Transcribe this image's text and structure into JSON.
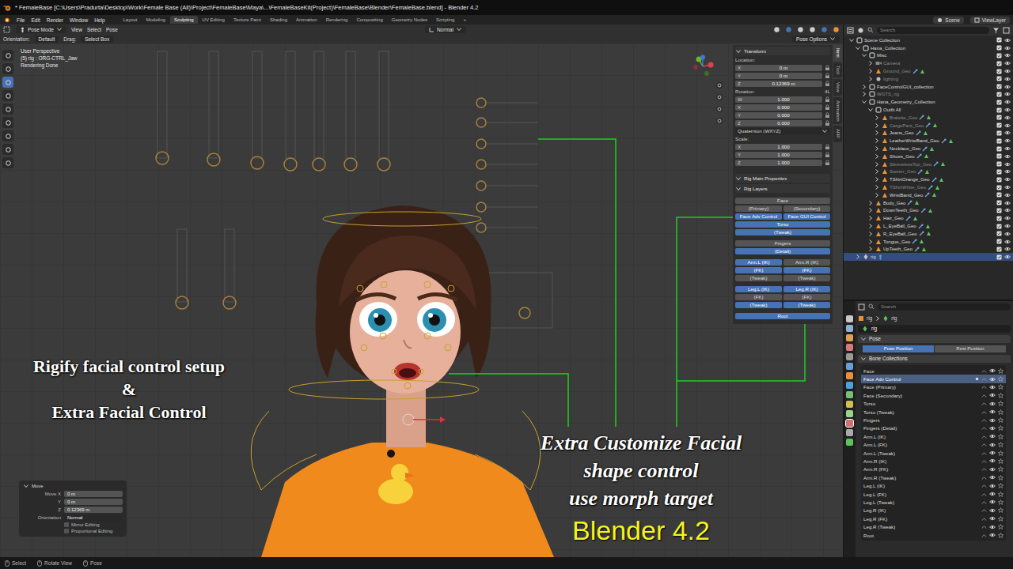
{
  "window": {
    "title": "* FemaleBase [C:\\Users\\Pradurta\\Desktop\\Work\\Female Base (All)\\Project\\FemaleBase\\Maya\\...\\FemaleBaseKit(Project)\\FemaleBase\\Blender\\FemaleBase.blend] - Blender 4.2"
  },
  "menu": [
    "File",
    "Edit",
    "Render",
    "Window",
    "Help"
  ],
  "workspaces": [
    {
      "label": "Layout",
      "selected": false
    },
    {
      "label": "Modeling",
      "selected": false
    },
    {
      "label": "Sculpting",
      "selected": true
    },
    {
      "label": "UV Editing",
      "selected": false
    },
    {
      "label": "Texture Paint",
      "selected": false
    },
    {
      "label": "Shading",
      "selected": false
    },
    {
      "label": "Animation",
      "selected": false
    },
    {
      "label": "Rendering",
      "selected": false
    },
    {
      "label": "Compositing",
      "selected": false
    },
    {
      "label": "Geometry Nodes",
      "selected": false
    },
    {
      "label": "Scripting",
      "selected": false
    },
    {
      "label": "+",
      "selected": false
    }
  ],
  "topbar_right": {
    "scene": "Scene",
    "view_layer": "ViewLayer"
  },
  "header": {
    "mode": "Pose Mode",
    "menus": [
      "View",
      "Select",
      "Pose"
    ],
    "transform": "Normal",
    "orientation_label": "Orientation:",
    "orientation": "Default",
    "drag_label": "Drag:",
    "drag": "Select Box",
    "options": "Pose Options"
  },
  "viewport": {
    "info": [
      "User Perspective",
      "(5) rig : ORG-CTRL_Jaw",
      "Rendering Done"
    ],
    "title_lines": [
      "Rigify facial control setup",
      "&",
      "Extra Facial Control"
    ],
    "caption_lines": [
      "Extra Customize Facial",
      "shape control",
      "use morph target"
    ],
    "version": "Blender 4.2"
  },
  "move_panel": {
    "title": "Move",
    "rows": [
      {
        "label": "Move X",
        "value": "0 m"
      },
      {
        "label": "Y",
        "value": "0 m"
      },
      {
        "label": "Z",
        "value": "0.12369 m"
      }
    ],
    "orientation_label": "Orientation",
    "orientation": "Normal",
    "checks": [
      {
        "label": "Mirror Editing",
        "checked": false
      },
      {
        "label": "Proportional Editing",
        "checked": false
      }
    ]
  },
  "npanel": {
    "tabs": [
      {
        "label": "Item",
        "selected": true
      },
      {
        "label": "Tool",
        "selected": false
      },
      {
        "label": "View",
        "selected": false
      },
      {
        "label": "Animation",
        "selected": false
      },
      {
        "label": "ARP",
        "selected": false
      }
    ],
    "transform": {
      "title": "Transform",
      "location_label": "Location:",
      "location": [
        {
          "axis": "X",
          "value": "0 m"
        },
        {
          "axis": "Y",
          "value": "0 m"
        },
        {
          "axis": "Z",
          "value": "0.12369 m"
        }
      ],
      "rotation_label": "Rotation:",
      "rotation_extra": "4L",
      "rotation": [
        {
          "axis": "W",
          "value": "1.000"
        },
        {
          "axis": "X",
          "value": "0.000"
        },
        {
          "axis": "Y",
          "value": "0.000"
        },
        {
          "axis": "Z",
          "value": "0.000"
        }
      ],
      "rotation_mode": "Quaternion (WXYZ)",
      "scale_label": "Scale:",
      "scale": [
        {
          "axis": "X",
          "value": "1.000"
        },
        {
          "axis": "Y",
          "value": "1.000"
        },
        {
          "axis": "Z",
          "value": "1.000"
        }
      ]
    },
    "sections": [
      "Rig Main Properties",
      "Rig Layers"
    ],
    "rig_layers": [
      [
        [
          {
            "label": "Face",
            "on": false
          }
        ],
        [
          {
            "label": "(Primary)",
            "on": false
          },
          {
            "label": "(Secondary)",
            "on": false
          }
        ],
        [
          {
            "label": "Face Adv Control",
            "on": true
          },
          {
            "label": "Face GUI Control",
            "on": true
          }
        ],
        [
          {
            "label": "Torso",
            "on": true
          }
        ],
        [
          {
            "label": "(Tweak)",
            "on": true
          }
        ]
      ],
      [
        [
          {
            "label": "Fingers",
            "on": false
          }
        ],
        [
          {
            "label": "(Detail)",
            "on": true
          }
        ]
      ],
      [
        [
          {
            "label": "Arm.L (IK)",
            "on": true
          },
          {
            "label": "Arm.R (IK)",
            "on": false
          }
        ],
        [
          {
            "label": "(FK)",
            "on": true
          },
          {
            "label": "(FK)",
            "on": true
          }
        ],
        [
          {
            "label": "(Tweak)",
            "on": false
          },
          {
            "label": "(Tweak)",
            "on": false
          }
        ]
      ],
      [
        [
          {
            "label": "Leg.L (IK)",
            "on": true
          },
          {
            "label": "Leg.R (IK)",
            "on": true
          }
        ],
        [
          {
            "label": "(FK)",
            "on": false
          },
          {
            "label": "(FK)",
            "on": false
          }
        ],
        [
          {
            "label": "(Tweak)",
            "on": true
          },
          {
            "label": "(Tweak)",
            "on": true
          }
        ]
      ],
      [
        [
          {
            "label": "Root",
            "on": true
          }
        ]
      ]
    ]
  },
  "outliner": {
    "search": "Search",
    "items": [
      {
        "label": "Scene Collection",
        "depth": 0,
        "kind": "collection",
        "expanded": true,
        "dim": false,
        "selected": false
      },
      {
        "label": "Hana_Collection",
        "depth": 1,
        "kind": "collection",
        "expanded": true,
        "dim": false,
        "selected": false
      },
      {
        "label": "Misc",
        "depth": 2,
        "kind": "collection",
        "expanded": true,
        "dim": false,
        "selected": false
      },
      {
        "label": "Camera",
        "depth": 3,
        "kind": "camera",
        "expanded": false,
        "dim": true,
        "selected": false
      },
      {
        "label": "Ground_Geo",
        "depth": 3,
        "kind": "mesh",
        "expanded": false,
        "dim": true,
        "selected": false
      },
      {
        "label": "lighting",
        "depth": 3,
        "kind": "light",
        "expanded": false,
        "dim": true,
        "selected": false
      },
      {
        "label": "FaceControlGUI_collection",
        "depth": 2,
        "kind": "collection",
        "expanded": false,
        "dim": false,
        "selected": false
      },
      {
        "label": "WGTS_rig",
        "depth": 2,
        "kind": "collection",
        "expanded": false,
        "dim": true,
        "selected": false
      },
      {
        "label": "Hana_Geometry_Collection",
        "depth": 2,
        "kind": "collection",
        "expanded": true,
        "dim": false,
        "selected": false
      },
      {
        "label": "Outfit All",
        "depth": 3,
        "kind": "collection",
        "expanded": true,
        "dim": false,
        "selected": false
      },
      {
        "label": "Bralette_Geo",
        "depth": 4,
        "kind": "mesh",
        "expanded": false,
        "dim": true,
        "selected": false
      },
      {
        "label": "CargoPant_Geo",
        "depth": 4,
        "kind": "mesh",
        "expanded": false,
        "dim": true,
        "selected": false
      },
      {
        "label": "Jeans_Geo",
        "depth": 4,
        "kind": "mesh",
        "expanded": false,
        "dim": false,
        "selected": false
      },
      {
        "label": "LeatherWristBand_Geo",
        "depth": 4,
        "kind": "mesh",
        "expanded": false,
        "dim": false,
        "selected": false
      },
      {
        "label": "Necklace_Geo",
        "depth": 4,
        "kind": "mesh",
        "expanded": false,
        "dim": false,
        "selected": false
      },
      {
        "label": "Shoes_Geo",
        "depth": 4,
        "kind": "mesh",
        "expanded": false,
        "dim": false,
        "selected": false
      },
      {
        "label": "SleevelessTop_Geo",
        "depth": 4,
        "kind": "mesh",
        "expanded": false,
        "dim": true,
        "selected": false
      },
      {
        "label": "Sweter_Geo",
        "depth": 4,
        "kind": "mesh",
        "expanded": false,
        "dim": true,
        "selected": false
      },
      {
        "label": "TShirtOrange_Geo",
        "depth": 4,
        "kind": "mesh",
        "expanded": false,
        "dim": false,
        "selected": false
      },
      {
        "label": "TShirtWhite_Geo",
        "depth": 4,
        "kind": "mesh",
        "expanded": false,
        "dim": true,
        "selected": false
      },
      {
        "label": "WristBand_Geo",
        "depth": 4,
        "kind": "mesh",
        "expanded": false,
        "dim": false,
        "selected": false
      },
      {
        "label": "Body_Geo",
        "depth": 3,
        "kind": "mesh",
        "expanded": false,
        "dim": false,
        "selected": false
      },
      {
        "label": "DownTeeth_Geo",
        "depth": 3,
        "kind": "mesh",
        "expanded": false,
        "dim": false,
        "selected": false
      },
      {
        "label": "Hair_Geo",
        "depth": 3,
        "kind": "mesh",
        "expanded": false,
        "dim": false,
        "selected": false
      },
      {
        "label": "L_EyeBall_Geo",
        "depth": 3,
        "kind": "mesh",
        "expanded": false,
        "dim": false,
        "selected": false
      },
      {
        "label": "R_EyeBall_Geo",
        "depth": 3,
        "kind": "mesh",
        "expanded": false,
        "dim": false,
        "selected": false
      },
      {
        "label": "Tongue_Geo",
        "depth": 3,
        "kind": "mesh",
        "expanded": false,
        "dim": false,
        "selected": false
      },
      {
        "label": "UpTeeth_Geo",
        "depth": 3,
        "kind": "mesh",
        "expanded": false,
        "dim": false,
        "selected": false
      },
      {
        "label": "rig",
        "depth": 1,
        "kind": "armature",
        "expanded": false,
        "dim": false,
        "selected": true
      }
    ]
  },
  "properties": {
    "search": "Search",
    "breadcrumb": [
      "rig",
      "rig"
    ],
    "name": "rig",
    "panel": "Pose",
    "positions": [
      {
        "label": "Pose Position",
        "selected": true
      },
      {
        "label": "Rest Position",
        "selected": false
      }
    ],
    "collections_title": "Bone Collections",
    "collections": [
      {
        "label": "Face",
        "selected": false
      },
      {
        "label": "Face Adv Control",
        "selected": true
      },
      {
        "label": "Face (Primary)",
        "selected": false
      },
      {
        "label": "Face (Secondary)",
        "selected": false
      },
      {
        "label": "Torso",
        "selected": false
      },
      {
        "label": "Torso (Tweak)",
        "selected": false
      },
      {
        "label": "Fingers",
        "selected": false
      },
      {
        "label": "Fingers (Detail)",
        "selected": false
      },
      {
        "label": "Arm.L (IK)",
        "selected": false
      },
      {
        "label": "Arm.L (FK)",
        "selected": false
      },
      {
        "label": "Arm.L (Tweak)",
        "selected": false
      },
      {
        "label": "Arm.R (IK)",
        "selected": false
      },
      {
        "label": "Arm.R (FK)",
        "selected": false
      },
      {
        "label": "Arm.R (Tweak)",
        "selected": false
      },
      {
        "label": "Leg.L (IK)",
        "selected": false
      },
      {
        "label": "Leg.L (FK)",
        "selected": false
      },
      {
        "label": "Leg.L (Tweak)",
        "selected": false
      },
      {
        "label": "Leg.R (IK)",
        "selected": false
      },
      {
        "label": "Leg.R (FK)",
        "selected": false
      },
      {
        "label": "Leg.R (Tweak)",
        "selected": false
      },
      {
        "label": "Root",
        "selected": false
      }
    ]
  },
  "status": [
    "Select",
    "Rotate View",
    "Pose"
  ]
}
